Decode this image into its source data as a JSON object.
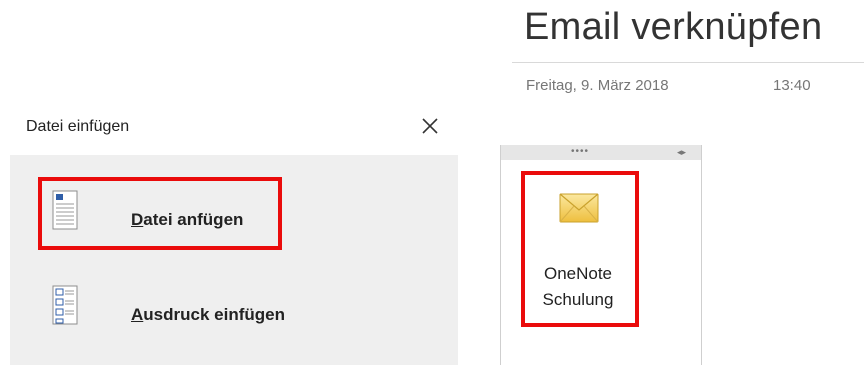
{
  "note": {
    "title": "Email verknüpfen",
    "date": "Freitag, 9. März 2018",
    "time": "13:40"
  },
  "dialog": {
    "title": "Datei einfügen",
    "close_icon": "close-icon",
    "options": [
      {
        "label_ul": "D",
        "label_rest": "atei anfügen",
        "icon": "document-icon",
        "highlighted": true
      },
      {
        "label_ul": "A",
        "label_rest": "usdruck einfügen",
        "icon": "printout-icon",
        "highlighted": false
      }
    ]
  },
  "attachment": {
    "name_line1": "OneNote",
    "name_line2": "Schulung",
    "icon": "envelope-icon",
    "highlighted": true
  },
  "colors": {
    "highlight": "#ea0b0b",
    "panel_bg": "#efefef",
    "envelope": "#f4cc55",
    "doc_accent": "#2f5ea8"
  }
}
